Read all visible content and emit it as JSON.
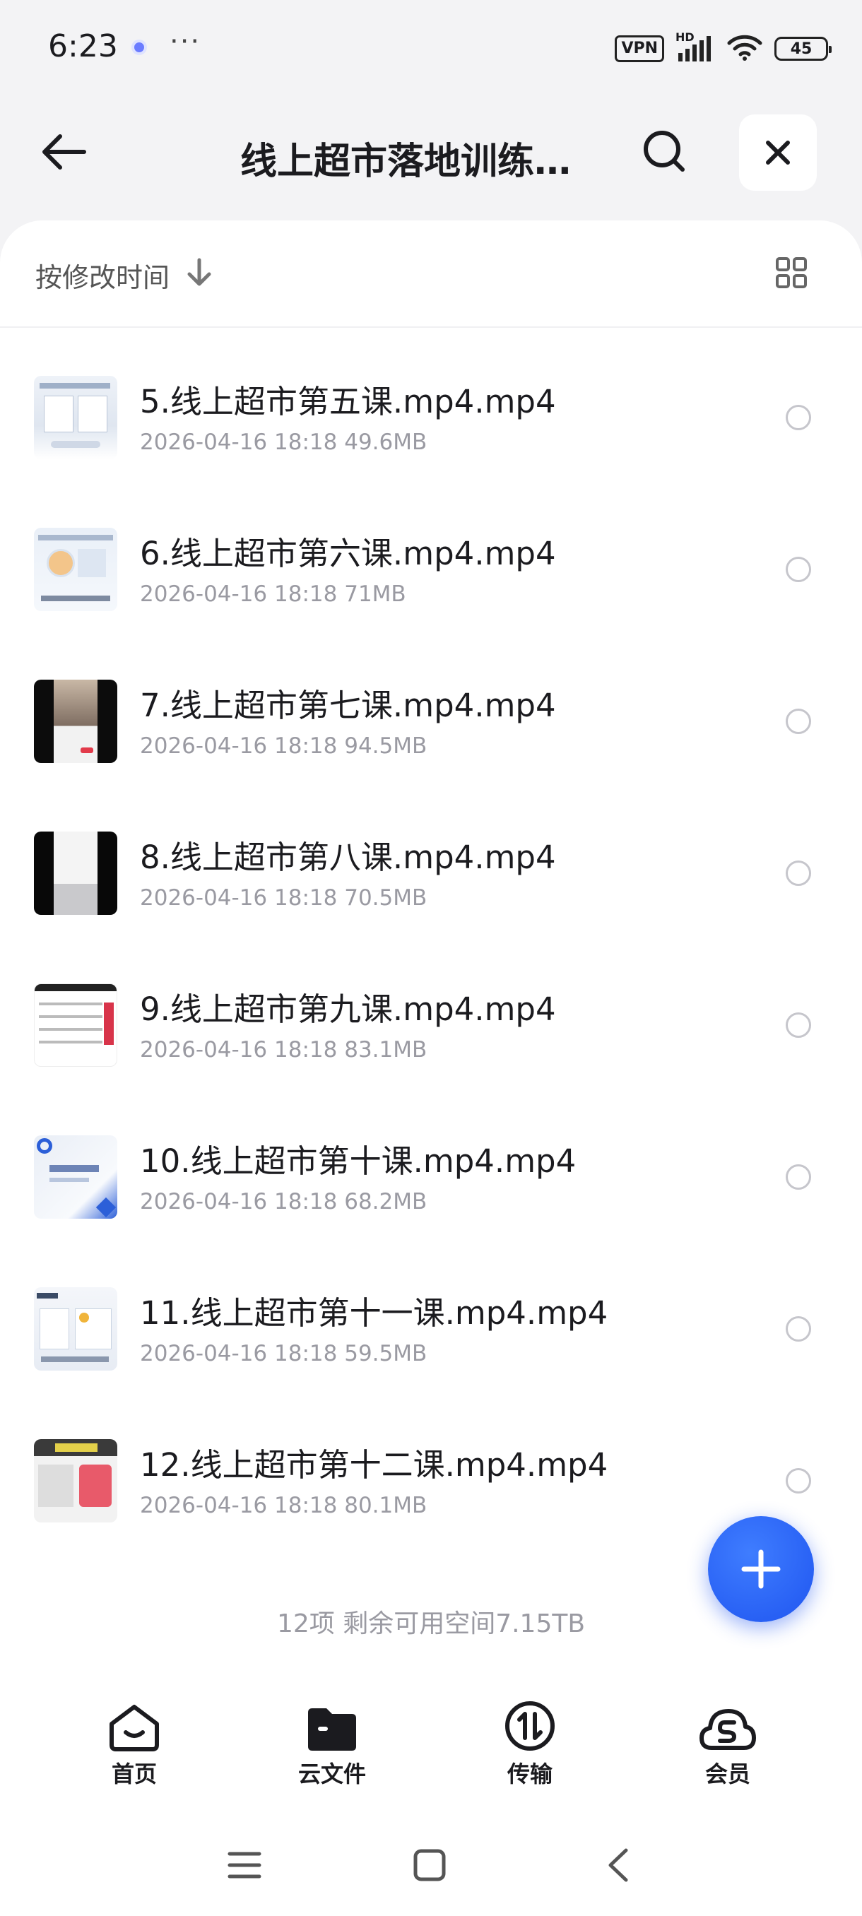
{
  "status_bar": {
    "time": "6:23",
    "more": "···",
    "vpn": "VPN",
    "network": "HD",
    "battery": "45"
  },
  "app_bar": {
    "title": "线上超市落地训练营（完结）",
    "icons": {
      "back": "back-arrow-icon",
      "search": "search-icon",
      "close": "close-icon"
    }
  },
  "sort": {
    "label": "按修改时间",
    "direction_icon": "arrow-down-icon",
    "view_toggle_icon": "grid-view-icon"
  },
  "files": [
    {
      "name": "5.线上超市第五课.mp4.mp4",
      "date": "2026-04-16 18:18",
      "size": "49.6MB"
    },
    {
      "name": "6.线上超市第六课.mp4.mp4",
      "date": "2026-04-16 18:18",
      "size": "71MB"
    },
    {
      "name": "7.线上超市第七课.mp4.mp4",
      "date": "2026-04-16 18:18",
      "size": "94.5MB"
    },
    {
      "name": "8.线上超市第八课.mp4.mp4",
      "date": "2026-04-16 18:18",
      "size": "70.5MB"
    },
    {
      "name": "9.线上超市第九课.mp4.mp4",
      "date": "2026-04-16 18:18",
      "size": "83.1MB"
    },
    {
      "name": "10.线上超市第十课.mp4.mp4",
      "date": "2026-04-16 18:18",
      "size": "68.2MB"
    },
    {
      "name": "11.线上超市第十一课.mp4.mp4",
      "date": "2026-04-16 18:18",
      "size": "59.5MB"
    },
    {
      "name": "12.线上超市第十二课.mp4.mp4",
      "date": "2026-04-16 18:18",
      "size": "80.1MB"
    }
  ],
  "summary": "12项 剩余可用空间7.15TB",
  "fab_icon": "plus-icon",
  "bottom_nav": [
    {
      "label": "首页",
      "icon": "home-icon"
    },
    {
      "label": "云文件",
      "icon": "folder-icon"
    },
    {
      "label": "传输",
      "icon": "transfer-icon"
    },
    {
      "label": "会员",
      "icon": "vip-cloud-icon"
    }
  ],
  "system_nav": {
    "menu": "menu-icon",
    "home": "square-home-icon",
    "back": "back-chevron-icon"
  },
  "colors": {
    "accent": "#1f55f0",
    "background": "#f3f3f5",
    "card": "#ffffff",
    "meta_text": "#9a9aa2"
  }
}
